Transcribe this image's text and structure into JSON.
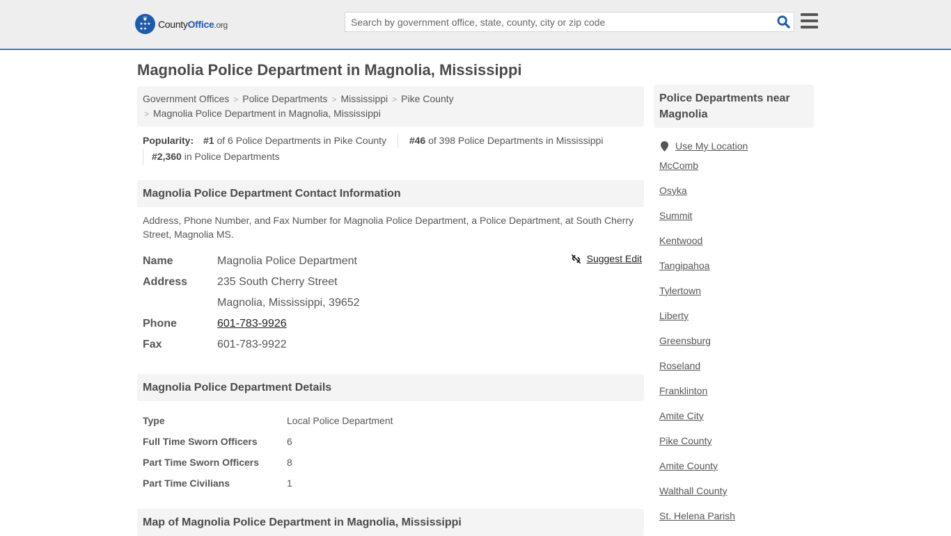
{
  "header": {
    "logo": {
      "name_part1": "County",
      "name_part2": "Office",
      "tld": ".org"
    },
    "search_placeholder": "Search by government office, state, county, city or zip code",
    "search_value": "",
    "colors": {
      "brand": "#1d5aa8",
      "header_bg": "#eeeeee",
      "header_border": "#3a7bbf"
    }
  },
  "page_title": "Magnolia Police Department in Magnolia, Mississippi",
  "breadcrumb": [
    {
      "label": "Government Offices"
    },
    {
      "label": "Police Departments"
    },
    {
      "label": "Mississippi"
    },
    {
      "label": "Pike County"
    },
    {
      "label": "Magnolia Police Department in Magnolia, Mississippi"
    }
  ],
  "popularity": {
    "label": "Popularity:",
    "items": [
      {
        "rank": "#1",
        "text": "of 6 Police Departments in Pike County"
      },
      {
        "rank": "#46",
        "text": "of 398 Police Departments in Mississippi"
      },
      {
        "rank": "#2,360",
        "text": "in Police Departments"
      }
    ]
  },
  "contact": {
    "heading": "Magnolia Police Department Contact Information",
    "description": "Address, Phone Number, and Fax Number for Magnolia Police Department, a Police Department, at South Cherry Street, Magnolia MS.",
    "suggest_edit": "Suggest Edit",
    "name_label": "Name",
    "name": "Magnolia Police Department",
    "address_label": "Address",
    "address_line1": "235 South Cherry Street",
    "address_line2": "Magnolia, Mississippi, 39652",
    "phone_label": "Phone",
    "phone": "601-783-9926",
    "fax_label": "Fax",
    "fax": "601-783-9922"
  },
  "details": {
    "heading": "Magnolia Police Department Details",
    "rows": [
      {
        "label": "Type",
        "value": "Local Police Department"
      },
      {
        "label": "Full Time Sworn Officers",
        "value": "6"
      },
      {
        "label": "Part Time Sworn Officers",
        "value": "8"
      },
      {
        "label": "Part Time Civilians",
        "value": "1"
      }
    ]
  },
  "map": {
    "heading": "Map of Magnolia Police Department in Magnolia, Mississippi"
  },
  "sidebar": {
    "heading": "Police Departments near Magnolia",
    "use_location": "Use My Location",
    "items": [
      "McComb",
      "Osyka",
      "Summit",
      "Kentwood",
      "Tangipahoa",
      "Tylertown",
      "Liberty",
      "Greensburg",
      "Roseland",
      "Franklinton",
      "Amite City",
      "Pike County",
      "Amite County",
      "Walthall County",
      "St. Helena Parish"
    ]
  }
}
